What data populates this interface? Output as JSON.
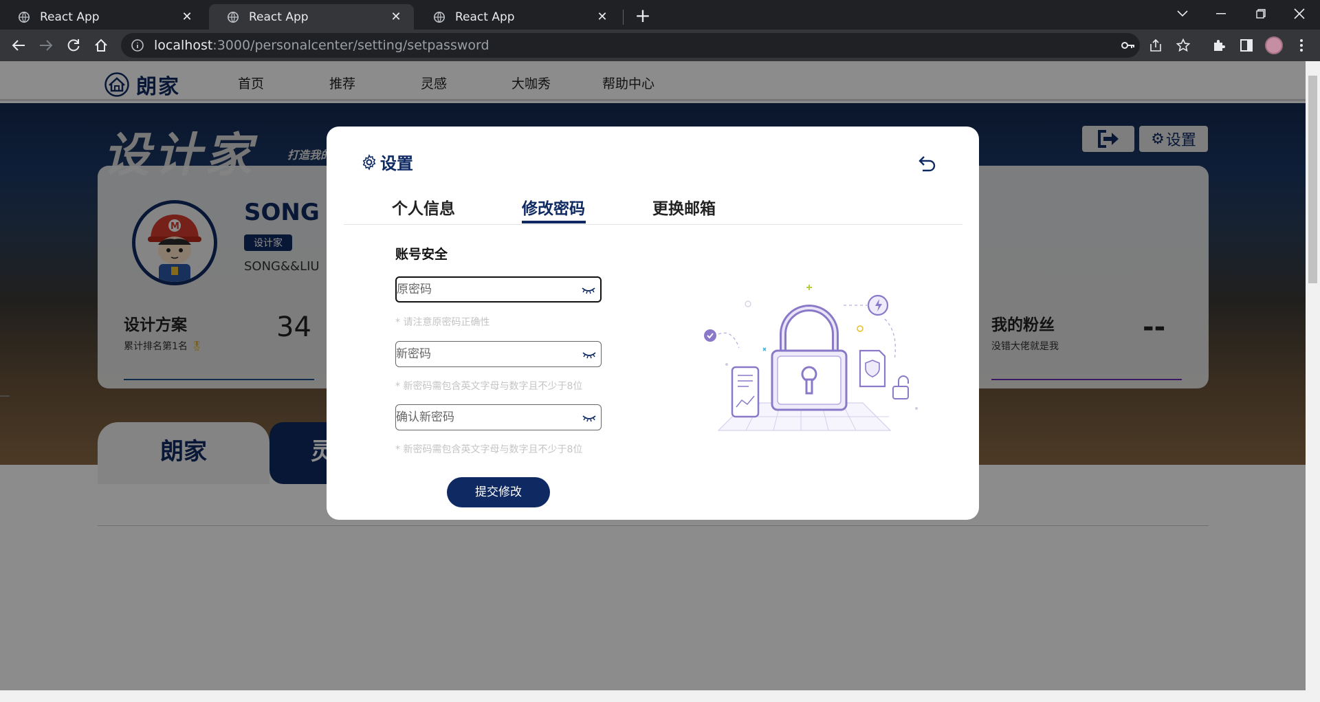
{
  "browser": {
    "tabs": [
      {
        "title": "React App"
      },
      {
        "title": "React App"
      },
      {
        "title": "React App"
      }
    ],
    "url_host": "localhost",
    "url_path": ":3000/personalcenter/setting/setpassword"
  },
  "nav": {
    "brand": "朗家",
    "links": [
      "首页",
      "推荐",
      "灵感",
      "大咖秀",
      "帮助中心"
    ]
  },
  "banner": {
    "title": "设计家",
    "slogan": "打造我的",
    "settings_label": "设置"
  },
  "profile": {
    "name": "SONG",
    "badge": "设计家",
    "user_id": "SONG&&LIU",
    "stats": [
      {
        "title": "设计方案",
        "sub": "累计排名第1名",
        "value": "34"
      },
      {
        "title": "我的粉丝",
        "sub": "没错大佬就是我",
        "value": "--"
      }
    ]
  },
  "sections": {
    "tab1": "朗家",
    "tab2": "灵"
  },
  "modal": {
    "title": "设置",
    "tabs": [
      "个人信息",
      "修改密码",
      "更换邮箱"
    ],
    "active_tab": "修改密码",
    "section_heading": "账号安全",
    "fields": [
      {
        "placeholder": "原密码",
        "value": "",
        "hint": "* 请注意原密码正确性"
      },
      {
        "placeholder": "新密码",
        "value": "",
        "hint": "* 新密码需包含英文字母与数字且不少于8位"
      },
      {
        "placeholder": "确认新密码",
        "value": "",
        "hint": "* 新密码需包含英文字母与数字且不少于8位"
      }
    ],
    "submit_label": "提交修改"
  },
  "colors": {
    "brand_navy": "#0f2a63",
    "illustration_purple": "#8a79c8",
    "fans_line": "#6a2bb0",
    "plan_line": "#1a4f8f"
  }
}
